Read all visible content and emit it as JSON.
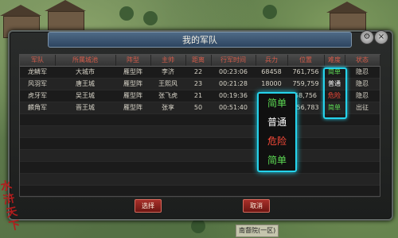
{
  "window": {
    "title": "我的军队"
  },
  "table": {
    "columns": [
      "军队",
      "所属城池",
      "阵型",
      "主帅",
      "距离",
      "行军时间",
      "兵力",
      "位置",
      "难度",
      "状态"
    ],
    "rows": [
      {
        "army": "龙鳞军",
        "city": "大城市",
        "formation": "雁型阵",
        "general": "李济",
        "distance": "22",
        "time": "00:23:06",
        "troops": "68458",
        "position": "761,756",
        "difficulty": "简单",
        "status": "隐忍"
      },
      {
        "army": "风羽军",
        "city": "唐王城",
        "formation": "雁型阵",
        "general": "王熙风",
        "distance": "23",
        "time": "00:21:28",
        "troops": "18000",
        "position": "759,759",
        "difficulty": "普通",
        "status": "隐忍"
      },
      {
        "army": "虎牙军",
        "city": "吴王城",
        "formation": "雁型阵",
        "general": "张飞虎",
        "distance": "21",
        "time": "00:19:36",
        "troops": "",
        "position": "58,756",
        "difficulty": "危险",
        "status": "隐忍"
      },
      {
        "army": "麟角军",
        "city": "晋王城",
        "formation": "雁型阵",
        "general": "张享",
        "distance": "50",
        "time": "00:51:40",
        "troops": "",
        "position": "756,783",
        "difficulty": "简单",
        "status": "出征"
      }
    ]
  },
  "difficulty_callout": [
    "简单",
    "普通",
    "危险",
    "简单"
  ],
  "buttons": {
    "select": "选择",
    "cancel": "取消"
  },
  "calligraphy": [
    "水",
    "浒",
    "天",
    "下"
  ],
  "map_label": "南督院(一区)",
  "window_buttons": {
    "settings": "⚙",
    "close": "×"
  }
}
